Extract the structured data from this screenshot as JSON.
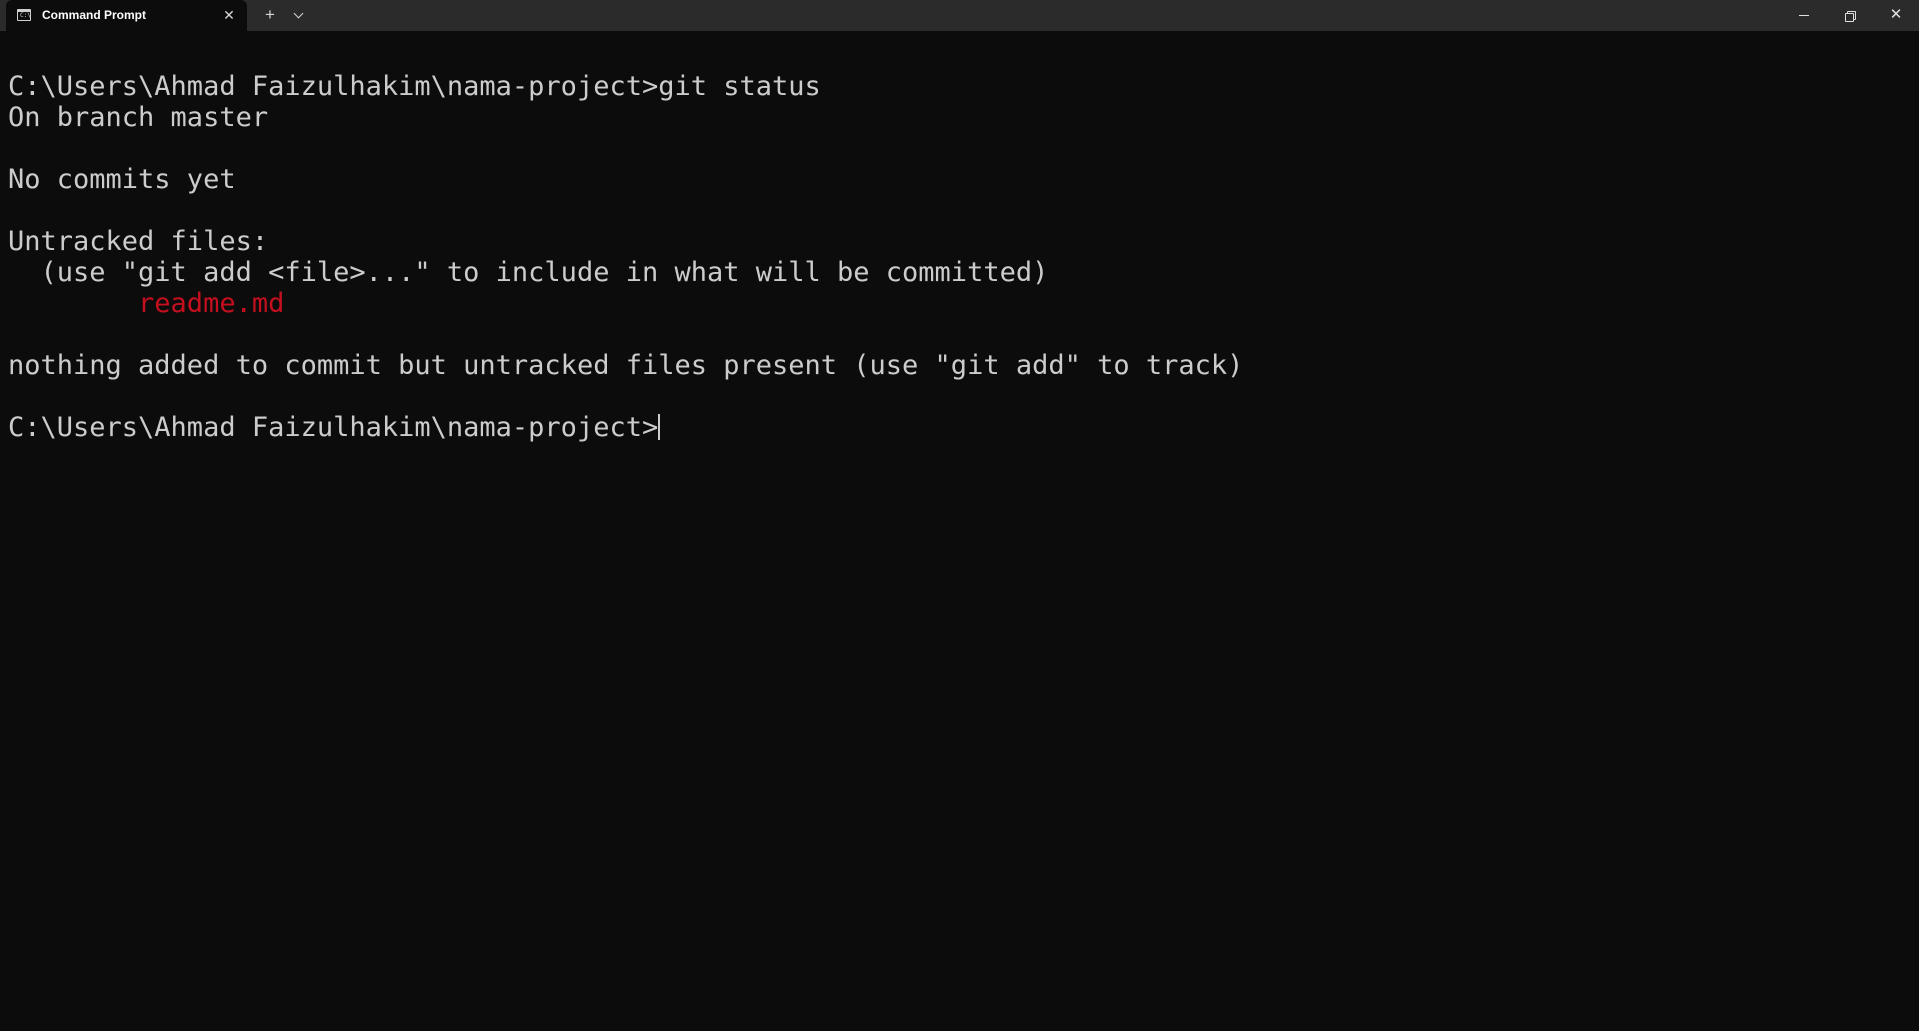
{
  "tab": {
    "title": "Command Prompt",
    "icon": "command-prompt-icon",
    "icon_text": "C:\\",
    "close_glyph": "✕"
  },
  "titlebar": {
    "new_tab_glyph": "+",
    "close_glyph": "✕"
  },
  "colors": {
    "terminal_bg": "#0c0c0c",
    "terminal_fg": "#cccccc",
    "untracked_file": "#c50f1f",
    "titlebar_bg": "#2b2b2b"
  },
  "terminal": {
    "lines": [
      "C:\\Users\\Ahmad Faizulhakim\\nama-project>git status",
      "On branch master",
      "",
      "No commits yet",
      "",
      "Untracked files:",
      "  (use \"git add <file>...\" to include in what will be committed)",
      "        readme.md",
      "",
      "nothing added to commit but untracked files present (use \"git add\" to track)",
      "",
      "C:\\Users\\Ahmad Faizulhakim\\nama-project>"
    ]
  }
}
